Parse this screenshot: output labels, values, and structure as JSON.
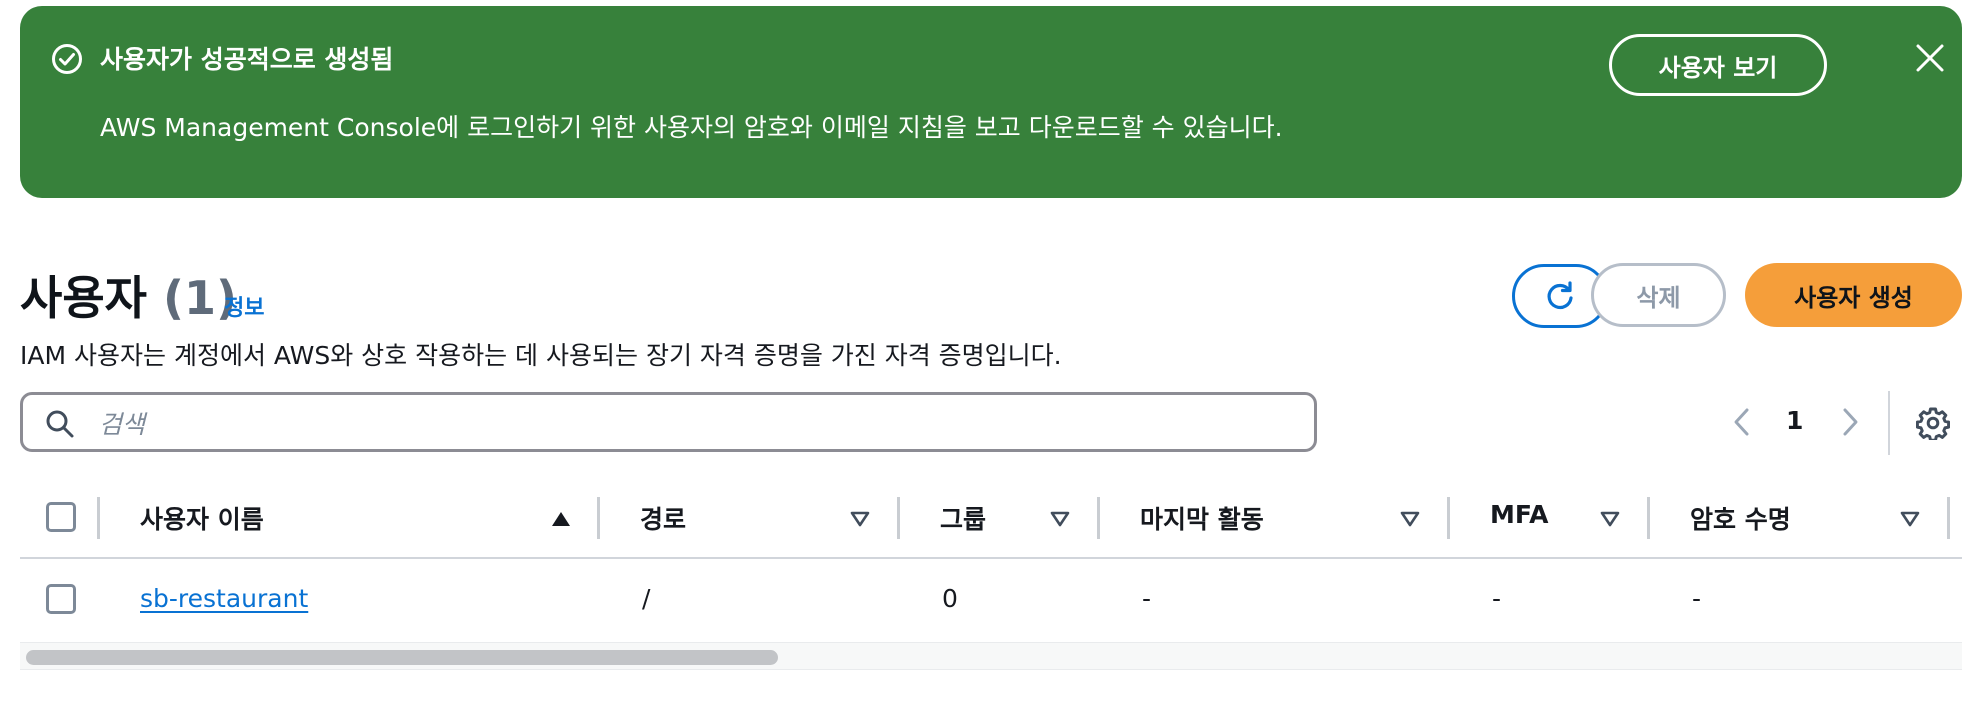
{
  "flash": {
    "title": "사용자가 성공적으로 생성됨",
    "message": "AWS Management Console에 로그인하기 위한 사용자의 암호와 이메일 지침을 보고 다운로드할 수 있습니다.",
    "view_button": "사용자 보기",
    "icons": {
      "status": "check-circle-icon",
      "close": "close-icon"
    },
    "color": "#37813b"
  },
  "header": {
    "title": "사용자",
    "count": "(1)",
    "info_link": "정보",
    "description": "IAM 사용자는 계정에서 AWS와 상호 작용하는 데 사용되는 장기 자격 증명을 가진 자격 증명입니다.",
    "delete_button": "삭제",
    "create_button": "사용자 생성",
    "refresh_icon": "refresh-icon",
    "primary_color": "#f59e3a"
  },
  "search": {
    "placeholder": "검색",
    "value": ""
  },
  "pagination": {
    "current_page": "1"
  },
  "table": {
    "columns": [
      {
        "label": "사용자 이름",
        "sort": "ascending"
      },
      {
        "label": "경로",
        "sort": "none"
      },
      {
        "label": "그룹",
        "sort": "none"
      },
      {
        "label": "마지막 활동",
        "sort": "none"
      },
      {
        "label": "MFA",
        "sort": "none"
      },
      {
        "label": "암호 수명",
        "sort": "none"
      }
    ],
    "rows": [
      {
        "user_name": "sb-restaurant",
        "path": "/",
        "groups": "0",
        "last_activity": "-",
        "mfa": "-",
        "password_age": "-"
      }
    ]
  }
}
